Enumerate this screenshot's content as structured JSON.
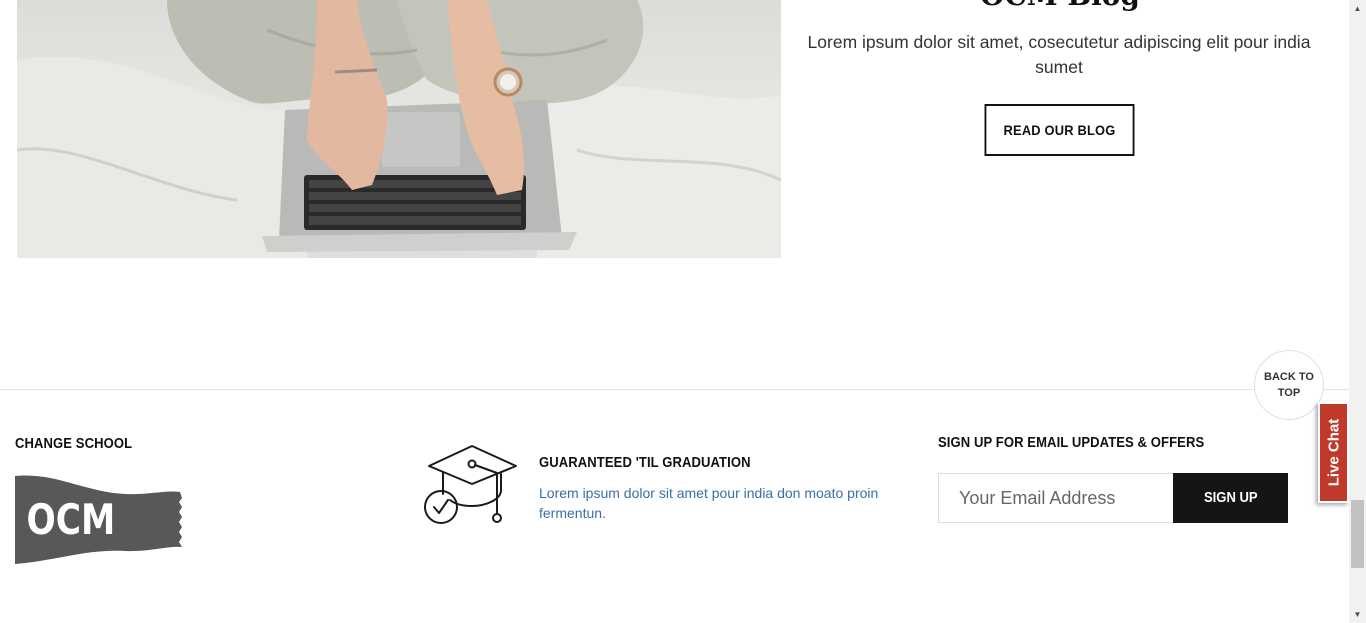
{
  "blog": {
    "title": "OCM Blog",
    "description": "Lorem ipsum dolor sit amet, cosecutetur adipiscing elit pour india sumet",
    "button_label": "READ OUR BLOG"
  },
  "back_to_top": {
    "line1": "BACK TO",
    "line2": "TOP"
  },
  "footer": {
    "change_school": {
      "heading": "CHANGE SCHOOL",
      "logo_text": "OCM"
    },
    "guarantee": {
      "icon": "graduation-cap-check-icon",
      "title": "GUARANTEED 'TIL GRADUATION",
      "description": "Lorem ipsum dolor sit amet pour india don moato proin fermentun."
    },
    "signup": {
      "heading": "SIGN UP FOR EMAIL UPDATES & OFFERS",
      "email_placeholder": "Your Email Address",
      "email_value": "",
      "button_label": "SIGN UP"
    }
  },
  "live_chat": {
    "label": "Live Chat"
  },
  "colors": {
    "accent_red": "#c0392b",
    "link_blue": "#3a6fa8",
    "button_dark": "#151515",
    "logo_gray": "#58585a"
  }
}
